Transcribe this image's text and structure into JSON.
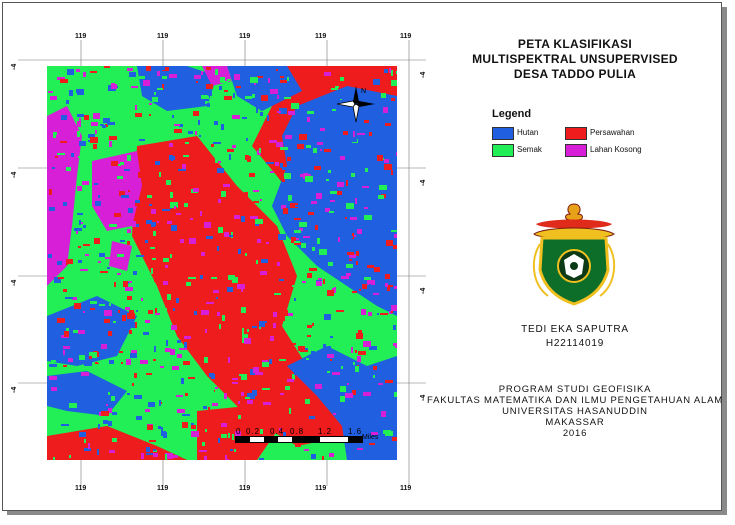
{
  "map": {
    "title_lines": [
      "PETA KLASIFIKASI",
      "MULTISPEKTRAL UNSUPERVISED",
      "DESA TADDO PULIA"
    ],
    "grid_top_labels": [
      "119",
      "119",
      "119",
      "119",
      "119"
    ],
    "grid_bottom_labels": [
      "119",
      "119",
      "119",
      "119",
      "119"
    ],
    "grid_left_labels": [
      "-4",
      "-4",
      "-4",
      "-4"
    ],
    "grid_right_labels": [
      "-4",
      "-4",
      "-4",
      "-4"
    ],
    "north_arrow_label": "N",
    "legend": {
      "title": "Legend",
      "items": [
        {
          "label": "Hutan",
          "color": "#1f5fe0"
        },
        {
          "label": "Persawahan",
          "color": "#ee1c1c"
        },
        {
          "label": "Semak",
          "color": "#22ee55"
        },
        {
          "label": "Lahan Kosong",
          "color": "#d81fd8"
        }
      ]
    },
    "scale": {
      "labels": [
        "0",
        "0.2",
        "0.4",
        "0.8",
        "1.2",
        "1.6"
      ],
      "unit": "Miles"
    },
    "author": {
      "name": "TEDI EKA SAPUTRA",
      "id": "H22114019"
    },
    "institution": {
      "lines": [
        "PROGRAM STUDI GEOFISIKA",
        "FAKULTAS MATEMATIKA DAN ILMU PENGETAHUAN ALAM",
        "UNIVERSITAS HASANUDDIN",
        "MAKASSAR",
        "2016"
      ]
    }
  }
}
